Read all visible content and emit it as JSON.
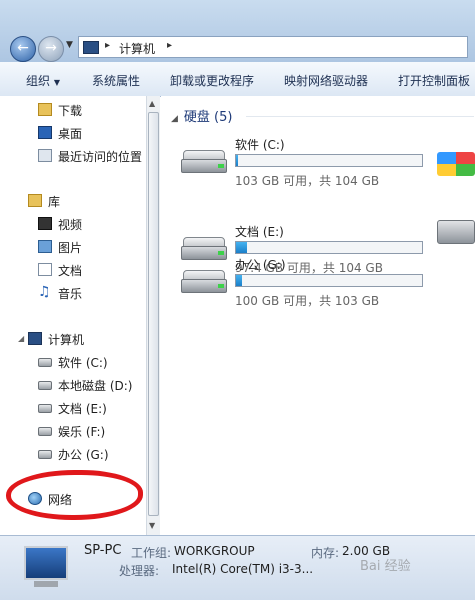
{
  "address_bar": {
    "path": [
      "计算机"
    ]
  },
  "toolbar": {
    "items": [
      "组织",
      "系统属性",
      "卸载或更改程序",
      "映射网络驱动器",
      "打开控制面板"
    ]
  },
  "sidebar": {
    "favorites": [
      {
        "label": "下载",
        "icon": "download-folder-icon"
      },
      {
        "label": "桌面",
        "icon": "desktop-icon"
      },
      {
        "label": "最近访问的位置",
        "icon": "recent-places-icon"
      }
    ],
    "libraries": {
      "label": "库",
      "items": [
        {
          "label": "视频",
          "icon": "video-icon"
        },
        {
          "label": "图片",
          "icon": "picture-icon"
        },
        {
          "label": "文档",
          "icon": "document-icon"
        },
        {
          "label": "音乐",
          "icon": "music-icon"
        }
      ]
    },
    "computer": {
      "label": "计算机",
      "drives": [
        "软件 (C:)",
        "本地磁盘 (D:)",
        "文档 (E:)",
        "娱乐 (F:)",
        "办公 (G:)"
      ]
    },
    "network": {
      "label": "网络"
    }
  },
  "content": {
    "group_header": "硬盘 (5)",
    "drives": [
      {
        "name": "软件 (C:)",
        "info": "103 GB 可用，共 104 GB",
        "used_fraction": 0.01
      },
      {
        "name": "文档 (E:)",
        "info": "97.4 GB 可用，共 104 GB",
        "used_fraction": 0.06
      },
      {
        "name": "办公 (G:)",
        "info": "100 GB 可用，共 103 GB",
        "used_fraction": 0.03
      }
    ]
  },
  "details": {
    "pc_name": "SP-PC",
    "workgroup_label": "工作组:",
    "workgroup_value": "WORKGROUP",
    "memory_label": "内存:",
    "memory_value": "2.00 GB",
    "cpu_label": "处理器:",
    "cpu_value": "Intel(R) Core(TM) i3-3..."
  },
  "watermark": "Bai 经验"
}
